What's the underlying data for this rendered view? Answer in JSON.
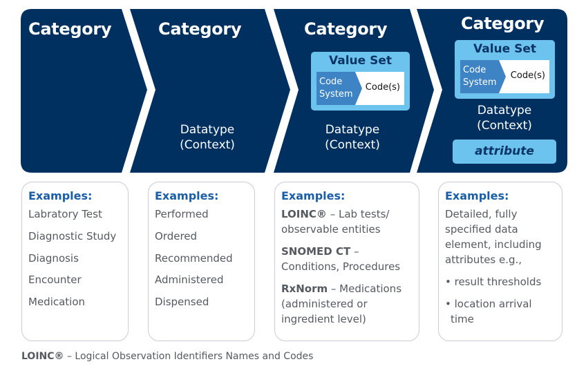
{
  "colors": {
    "panel_navy": "#00305f",
    "light_blue": "#6cc3ee",
    "code_system_blue": "#3e84c5",
    "heading_blue": "#1a5ea8",
    "body_gray": "#555a60",
    "card_border": "#c9cbd8"
  },
  "columns": [
    {
      "title": "Category",
      "examples_heading": "Examples:",
      "examples": [
        "Labratory Test",
        "Diagnostic Study",
        "Diagnosis",
        "Encounter",
        "Medication"
      ]
    },
    {
      "title": "Category",
      "datatype_line1": "Datatype",
      "datatype_line2": "(Context)",
      "examples_heading": "Examples:",
      "examples": [
        "Performed",
        "Ordered",
        "Recommended",
        "Administered",
        "Dispensed"
      ]
    },
    {
      "title": "Category",
      "value_set": {
        "title": "Value Set",
        "code_system_line1": "Code",
        "code_system_line2": "System",
        "codes": "Code(s)"
      },
      "datatype_line1": "Datatype",
      "datatype_line2": "(Context)",
      "examples_heading": "Examples:",
      "examples": [
        {
          "bold": "LOINC®",
          "text_line1": " – Lab tests/",
          "text_line2": "observable entities"
        },
        {
          "bold": "SNOMED CT",
          "text_line1": " –",
          "text_line2": "Conditions, Procedures"
        },
        {
          "bold": "RxNorm",
          "text_line1": " – Medications",
          "text_line2": "(administered or",
          "text_line3": "ingredient level)"
        }
      ]
    },
    {
      "title": "Category",
      "value_set": {
        "title": "Value Set",
        "code_system_line1": "Code",
        "code_system_line2": "System",
        "codes": "Code(s)"
      },
      "datatype_line1": "Datatype",
      "datatype_line2": "(Context)",
      "attribute": "attribute",
      "examples_heading": "Examples:",
      "description": [
        "Detailed, fully",
        "specified data",
        "element, including",
        "attributes e.g.,"
      ],
      "bullets": [
        {
          "line1": "• result thresholds"
        },
        {
          "line1": "• location arrival",
          "line2": "time"
        }
      ]
    }
  ],
  "footnote": {
    "bold": "LOINC®",
    "text": " – Logical Observation Identifiers Names and Codes"
  }
}
